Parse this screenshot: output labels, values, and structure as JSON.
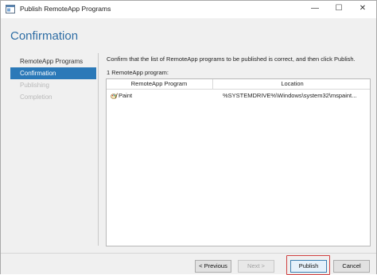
{
  "window": {
    "title": "Publish RemoteApp Programs",
    "controls": {
      "minimize": "—",
      "maximize": "☐",
      "close": "✕"
    }
  },
  "page": {
    "title": "Confirmation"
  },
  "nav": {
    "items": [
      {
        "label": "RemoteApp Programs",
        "state": "normal"
      },
      {
        "label": "Confirmation",
        "state": "active"
      },
      {
        "label": "Publishing",
        "state": "disabled"
      },
      {
        "label": "Completion",
        "state": "disabled"
      }
    ]
  },
  "content": {
    "instruction": "Confirm that the list of RemoteApp programs to be published is correct, and then click Publish.",
    "count_label": "1 RemoteApp program:",
    "table": {
      "columns": [
        "RemoteApp Program",
        "Location"
      ],
      "rows": [
        {
          "program": "Paint",
          "location": "%SYSTEMDRIVE%\\Windows\\system32\\mspaint..."
        }
      ]
    }
  },
  "buttons": {
    "previous": "< Previous",
    "next": "Next >",
    "publish": "Publish",
    "cancel": "Cancel"
  },
  "colors": {
    "accent": "#2b79b8",
    "title": "#2e6da4",
    "highlight": "#d04040"
  },
  "icons": {
    "app": "remoteapp-window-icon",
    "paint": "paint-icon"
  }
}
